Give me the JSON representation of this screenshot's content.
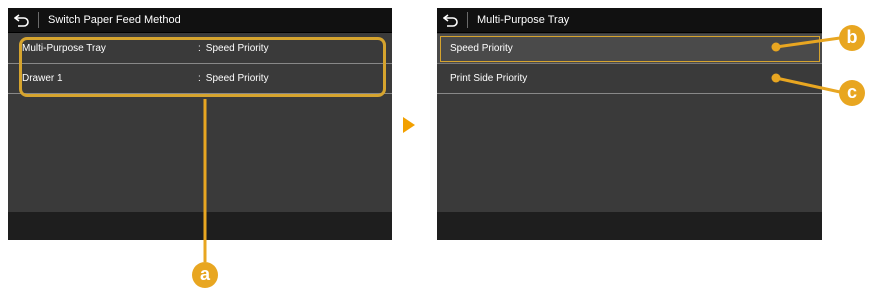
{
  "left_screen": {
    "title": "Switch Paper Feed Method",
    "rows": [
      {
        "label": "Multi-Purpose Tray",
        "colon": ":",
        "value": "Speed Priority"
      },
      {
        "label": "Drawer 1",
        "colon": ":",
        "value": "Speed Priority"
      }
    ]
  },
  "right_screen": {
    "title": "Multi-Purpose Tray",
    "options": [
      {
        "label": "Speed Priority"
      },
      {
        "label": "Print Side Priority"
      }
    ]
  },
  "callouts": {
    "a": "a",
    "b": "b",
    "c": "c"
  },
  "colors": {
    "callout": "#e8a621",
    "arrow": "#f2a000",
    "screen_bg": "#3a3a3a",
    "title_bg": "#111111"
  },
  "icons": [
    "back-arrow-icon",
    "next-arrow-icon"
  ]
}
